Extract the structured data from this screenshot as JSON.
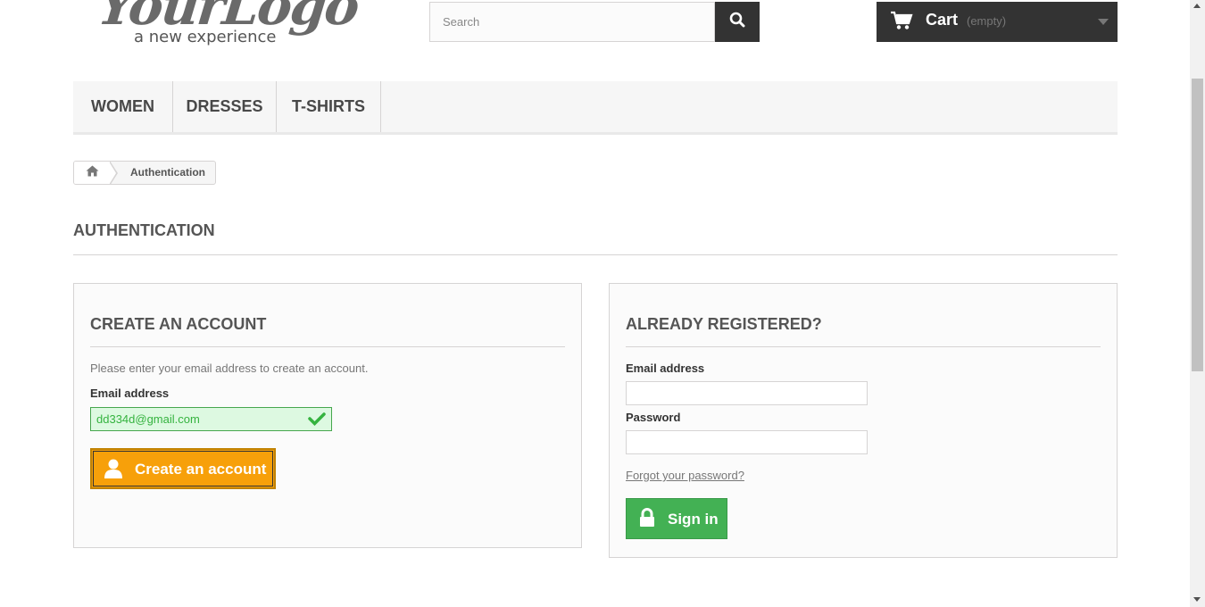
{
  "logo": {
    "main": "YourLogo",
    "tagline": "a new experience"
  },
  "search": {
    "placeholder": "Search",
    "icon": "search-icon"
  },
  "cart": {
    "label": "Cart",
    "status": "(empty)",
    "icon": "cart-icon"
  },
  "menu": {
    "items": [
      {
        "label": "Women"
      },
      {
        "label": "Dresses"
      },
      {
        "label": "T-shirts"
      }
    ]
  },
  "breadcrumb": {
    "home_icon": "home-icon",
    "current": "Authentication"
  },
  "page": {
    "heading": "Authentication"
  },
  "create_account": {
    "title": "Create an account",
    "info": "Please enter your email address to create an account.",
    "email_label": "Email address",
    "email_value": "dd334d@gmail.com",
    "email_valid": true,
    "button_label": "Create an account",
    "button_icon": "user-icon"
  },
  "login": {
    "title": "Already registered?",
    "email_label": "Email address",
    "email_value": "",
    "password_label": "Password",
    "password_value": "",
    "forgot_link": "Forgot your password?",
    "button_label": "Sign in",
    "button_icon": "lock-icon"
  },
  "colors": {
    "create_button": "#f7a00a",
    "signin_button": "#43b154",
    "valid_field_bg": "#ddf9e1",
    "header_dark": "#333333"
  }
}
